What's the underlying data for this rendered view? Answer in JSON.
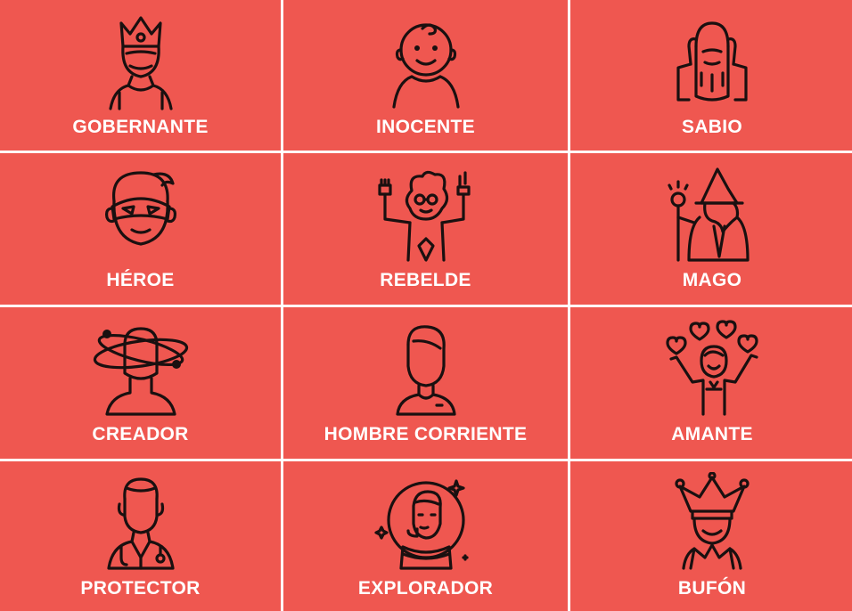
{
  "archetypes": [
    {
      "label": "GOBERNANTE",
      "icon": "crowned-ruler-icon"
    },
    {
      "label": "INOCENTE",
      "icon": "baby-icon"
    },
    {
      "label": "SABIO",
      "icon": "bearded-sage-icon"
    },
    {
      "label": "HÉROE",
      "icon": "masked-hero-icon"
    },
    {
      "label": "REBELDE",
      "icon": "rebel-rock-hands-icon"
    },
    {
      "label": "MAGO",
      "icon": "wizard-icon"
    },
    {
      "label": "CREADOR",
      "icon": "creator-orbit-icon"
    },
    {
      "label": "HOMBRE CORRIENTE",
      "icon": "everyman-icon"
    },
    {
      "label": "AMANTE",
      "icon": "lover-hearts-icon"
    },
    {
      "label": "PROTECTOR",
      "icon": "doctor-protector-icon"
    },
    {
      "label": "EXPLORADOR",
      "icon": "astronaut-explorer-icon"
    },
    {
      "label": "BUFÓN",
      "icon": "jester-icon"
    }
  ],
  "colors": {
    "tile_background": "#ef5750",
    "grid_lines": "#ffffff",
    "label_text": "#ffffff",
    "icon_stroke": "#1a1010"
  }
}
